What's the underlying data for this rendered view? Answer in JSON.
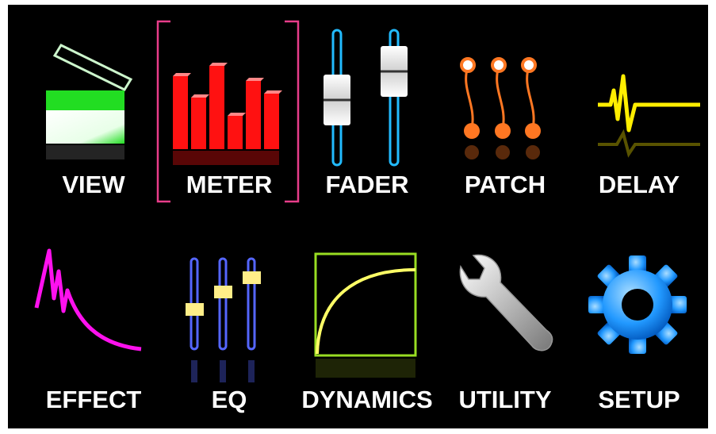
{
  "menu": {
    "items": [
      {
        "id": "view",
        "label": "VIEW",
        "icon": "clapperboard-icon",
        "color": "#22dd22"
      },
      {
        "id": "meter",
        "label": "METER",
        "icon": "bar-meter-icon",
        "color": "#ff1111",
        "selected": true
      },
      {
        "id": "fader",
        "label": "FADER",
        "icon": "fader-icon",
        "color": "#22bbff"
      },
      {
        "id": "patch",
        "label": "PATCH",
        "icon": "patch-cable-icon",
        "color": "#ff7722"
      },
      {
        "id": "delay",
        "label": "DELAY",
        "icon": "delay-waveform-icon",
        "color": "#ffee00"
      },
      {
        "id": "effect",
        "label": "EFFECT",
        "icon": "reverb-decay-icon",
        "color": "#ff11ee"
      },
      {
        "id": "eq",
        "label": "EQ",
        "icon": "eq-sliders-icon",
        "color": "#5566ff"
      },
      {
        "id": "dynamics",
        "label": "DYNAMICS",
        "icon": "compressor-curve-icon",
        "color": "#99dd22"
      },
      {
        "id": "utility",
        "label": "UTILITY",
        "icon": "wrench-icon",
        "color": "#cccccc"
      },
      {
        "id": "setup",
        "label": "SETUP",
        "icon": "gear-icon",
        "color": "#2299ff"
      }
    ],
    "selection_color": "#e83d8a"
  }
}
